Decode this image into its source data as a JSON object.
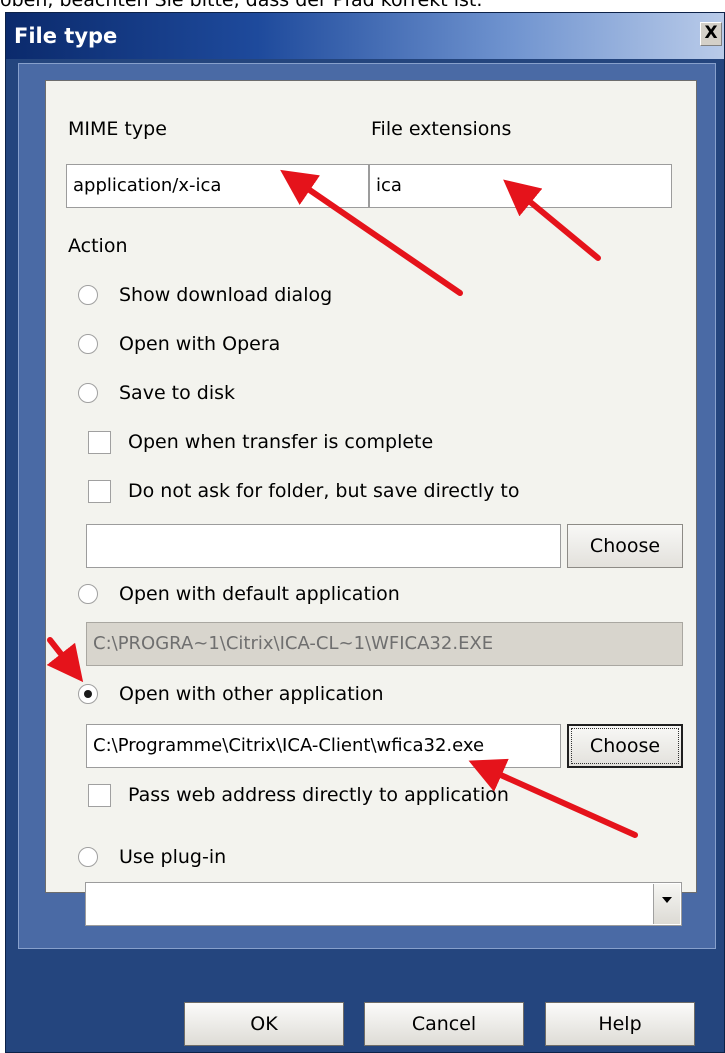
{
  "caption": "oben, beachten Sie bitte, dass der Pfad korrekt ist.",
  "window": {
    "title": "File type",
    "close_label": "X"
  },
  "mime": {
    "label": "MIME type",
    "value": "application/x-ica"
  },
  "extensions": {
    "label": "File extensions",
    "value": "ica"
  },
  "action": {
    "label": "Action",
    "options": [
      {
        "label": "Show download dialog",
        "selected": false
      },
      {
        "label": "Open with Opera",
        "selected": false
      },
      {
        "label": "Save to disk",
        "selected": false
      },
      {
        "label": "Open with default application",
        "selected": false
      },
      {
        "label": "Open with other application",
        "selected": true
      },
      {
        "label": "Use plug-in",
        "selected": false
      }
    ]
  },
  "save": {
    "open_when_complete": {
      "label": "Open when transfer is complete",
      "checked": false
    },
    "no_ask_folder": {
      "label": "Do not ask for folder, but save directly to",
      "checked": false
    },
    "folder_value": "",
    "choose_label": "Choose"
  },
  "default_app": {
    "value": "C:\\PROGRA~1\\Citrix\\ICA-CL~1\\WFICA32.EXE"
  },
  "other_app": {
    "value": "C:\\Programme\\Citrix\\ICA-Client\\wfica32.exe",
    "choose_label": "Choose",
    "pass_web": {
      "label": "Pass web address directly to application",
      "checked": false
    }
  },
  "plugin": {
    "selected_value": ""
  },
  "footer": {
    "ok": "OK",
    "cancel": "Cancel",
    "help": "Help"
  },
  "colors": {
    "annotation_arrow": "#e5131b",
    "title_bar": "#1e4a9c"
  }
}
